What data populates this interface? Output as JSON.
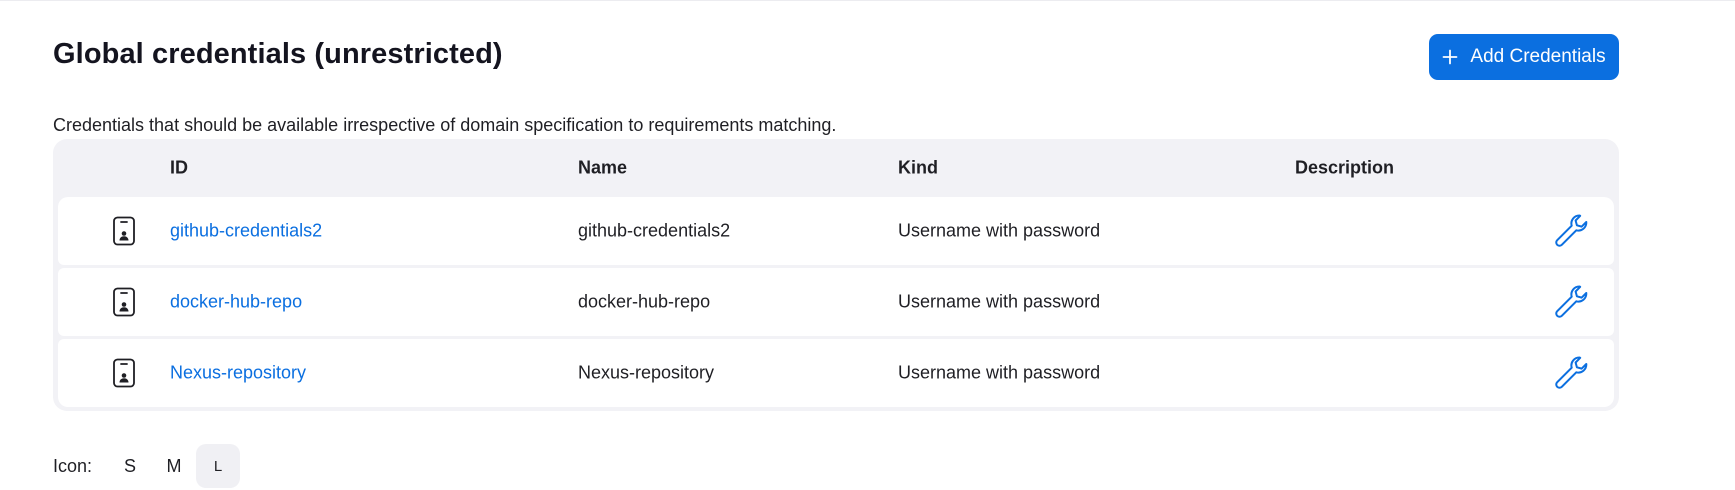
{
  "page": {
    "title": "Global credentials (unrestricted)",
    "description": "Credentials that should be available irrespective of domain specification to requirements matching."
  },
  "toolbar": {
    "add_label": "Add Credentials"
  },
  "table": {
    "columns": {
      "id": "ID",
      "name": "Name",
      "kind": "Kind",
      "description": "Description"
    },
    "rows": [
      {
        "id": "github-credentials2",
        "name": "github-credentials2",
        "kind": "Username with password",
        "description": ""
      },
      {
        "id": "docker-hub-repo",
        "name": "docker-hub-repo",
        "kind": "Username with password",
        "description": ""
      },
      {
        "id": "Nexus-repository",
        "name": "Nexus-repository",
        "kind": "Username with password",
        "description": ""
      }
    ]
  },
  "icon_size": {
    "label": "Icon:",
    "options": [
      "S",
      "M",
      "L"
    ],
    "selected": "L"
  },
  "colors": {
    "accent": "#0b6fe0",
    "table_bg": "#f2f2f6"
  },
  "icons": {
    "row_type": "credential-card-icon",
    "row_action": "wrench-icon",
    "add": "plus-icon"
  }
}
